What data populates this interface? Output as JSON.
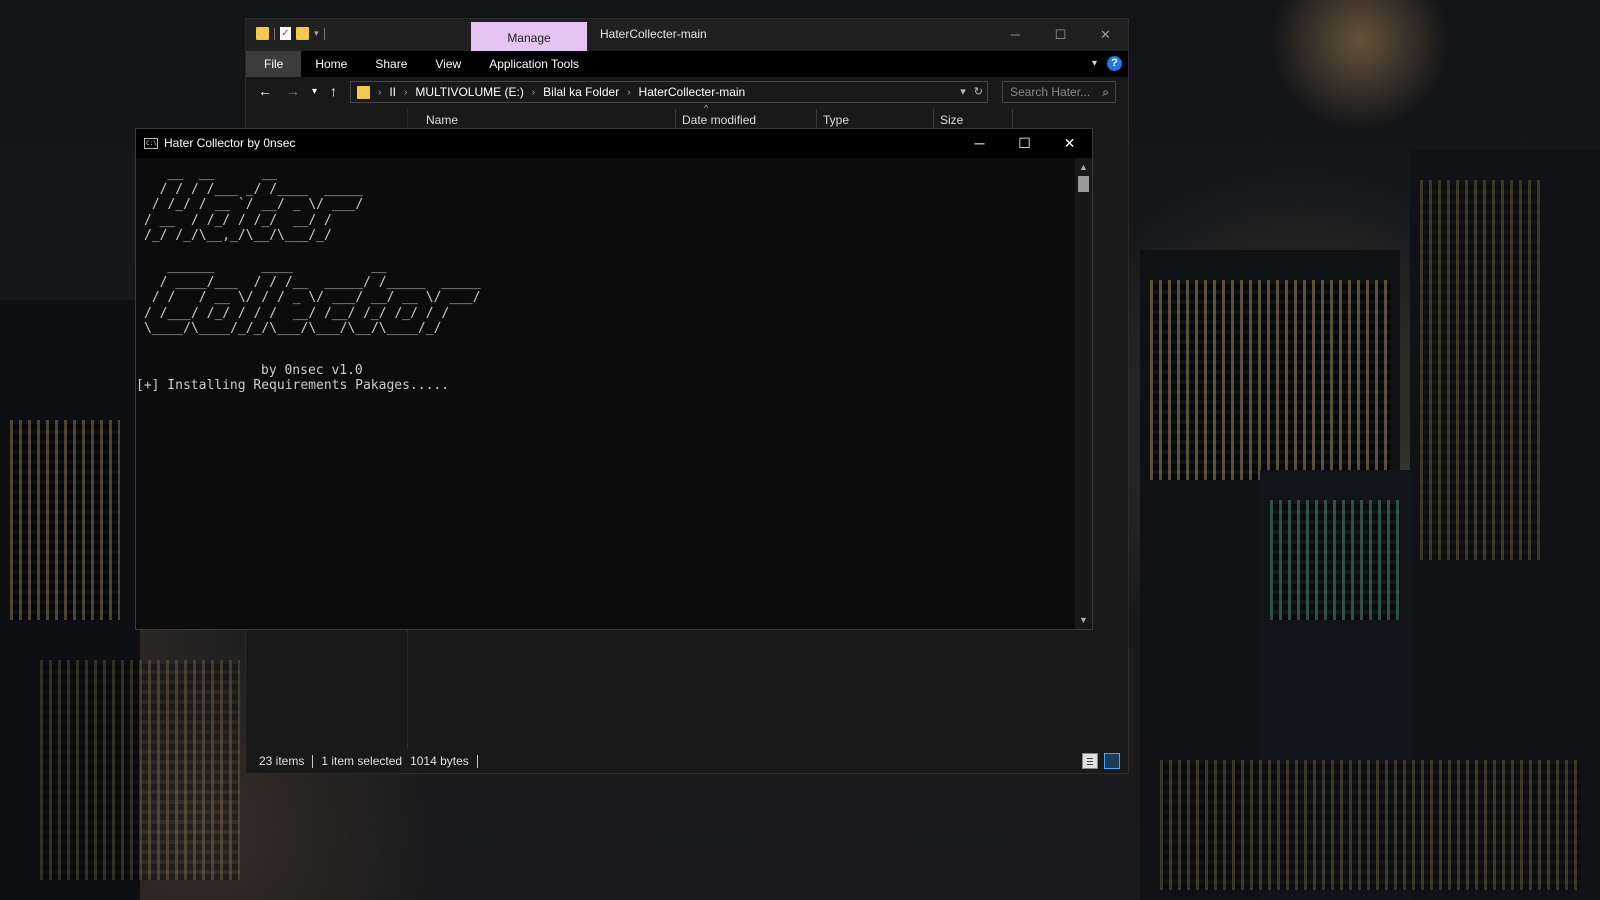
{
  "explorer": {
    "manage_tab": "Manage",
    "window_title": "HaterCollecter-main",
    "ribbon_tabs": [
      "File",
      "Home",
      "Share",
      "View",
      "Application Tools"
    ],
    "address": [
      "II",
      "MULTIVOLUME (E:)",
      "Bilal ka Folder",
      "HaterCollecter-main"
    ],
    "search_placeholder": "Search Hater...",
    "columns": [
      "Name",
      "Date modified",
      "Type",
      "Size"
    ],
    "status": {
      "items": "23 items",
      "selected": "1 item selected",
      "size": "1014 bytes"
    }
  },
  "console": {
    "title": "Hater Collector by 0nsec",
    "banner_lines": [
      "   __  __      __           ",
      "  / / / /___ _/ /____  _____",
      " / /_/ / __ `/ __/ _ \\/ ___/",
      "/ __  / /_/ / /_/  __/ /    ",
      "/_/ /_/\\__,_/\\__/\\___/_/     ",
      "",
      "   ______      ____          __            ",
      "  / ____/___  / / /__  _____/ /_____  _____",
      " / /   / __ \\/ / / _ \\/ ___/ __/ __ \\/ ___/",
      "/ /___/ /_/ / / /  __/ /__/ /_/ /_/ / /    ",
      "\\____/\\____/_/_/\\___/\\___/\\__/\\____/_/     "
    ],
    "by_line": "by 0nsec v1.0",
    "status_line": "[+] Installing Requirements Pakages....."
  }
}
